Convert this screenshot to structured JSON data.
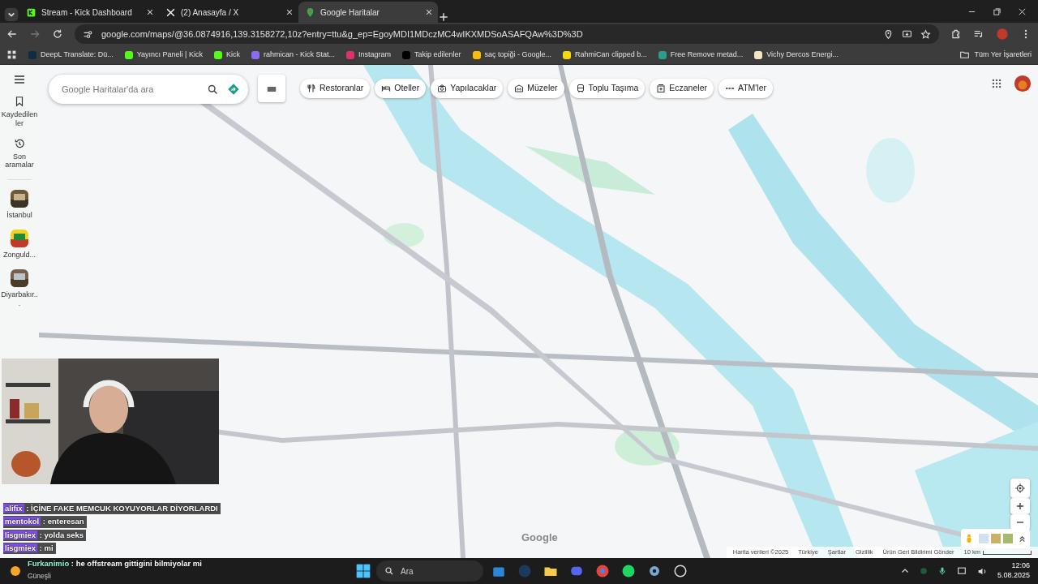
{
  "browser": {
    "tabs": [
      {
        "title": "Stream - Kick Dashboard",
        "kind": "kick",
        "selected": false
      },
      {
        "title": "(2) Anasayfa / X",
        "kind": "x",
        "selected": false
      },
      {
        "title": "Google Haritalar",
        "kind": "maps",
        "selected": true
      }
    ],
    "url": "google.com/maps/@36.0874916,139.3158272,10z?entry=ttu&g_ep=EgoyMDI1MDczMC4wIKXMDSoASAFQAw%3D%3D",
    "bookmarks": [
      {
        "label": "DeepL Translate: Dü...",
        "color": "#0f2b46"
      },
      {
        "label": "Yayıncı Paneli | Kick",
        "color": "#53fc18"
      },
      {
        "label": "Kick",
        "color": "#53fc18"
      },
      {
        "label": "rahmican - Kick Stat...",
        "color": "#8a6cf0"
      },
      {
        "label": "Instagram",
        "color": "#e1306c"
      },
      {
        "label": "Takip edilenler",
        "color": "#000000"
      },
      {
        "label": "saç topiği - Google...",
        "color": "#fbbc04"
      },
      {
        "label": "RahmiCan clipped b...",
        "color": "#f5d90a"
      },
      {
        "label": "Free Remove metad...",
        "color": "#2a9d8f"
      },
      {
        "label": "Vichy Dercos Energi...",
        "color": "#f3e6c4"
      }
    ],
    "all_bookmarks": "Tüm Yer İşaretleri"
  },
  "maps": {
    "search": {
      "placeholder": "Google Haritalar'da ara"
    },
    "chips": [
      {
        "label": "Restoranlar",
        "kind": "fork"
      },
      {
        "label": "Oteller",
        "kind": "bed"
      },
      {
        "label": "Yapılacaklar",
        "kind": "camera"
      },
      {
        "label": "Müzeler",
        "kind": "museum"
      },
      {
        "label": "Toplu Taşıma",
        "kind": "bus"
      },
      {
        "label": "Eczaneler",
        "kind": "pharmacy"
      },
      {
        "label": "ATM'ler",
        "kind": "atm"
      }
    ],
    "sidebar": [
      {
        "label": "Kaydedilenler",
        "kind": "saved"
      },
      {
        "label": "Son aramalar",
        "kind": "recent"
      }
    ],
    "recent_places": [
      {
        "label": "İstanbul"
      },
      {
        "label": "Zonguld..."
      },
      {
        "label": "Diyarbakır..."
      }
    ],
    "logo": "Google",
    "footer": [
      "Harita verileri ©2025",
      "Türkiye",
      "Şartlar",
      "Gizlilik",
      "Ürün Geri Bildirimi Gönder"
    ],
    "scale": "10 km"
  },
  "chat": {
    "messages": [
      {
        "user": "alifix",
        "text": ": İÇİNE FAKE MEMCUK KOYUYORLAR DİYORLARDI"
      },
      {
        "user": "mentokol",
        "text": ": enteresan"
      },
      {
        "user": "lisgmiex",
        "text": ": yolda seks"
      },
      {
        "user": "lisgmiex",
        "text": ": mi"
      }
    ],
    "latest": {
      "user": "Furkanimio",
      "text": ": he offstream gittigini bilmiyolar mi"
    }
  },
  "taskbar": {
    "weather": "Güneşli",
    "search": "Ara",
    "time": "12:06",
    "date": "5.08.2025"
  }
}
